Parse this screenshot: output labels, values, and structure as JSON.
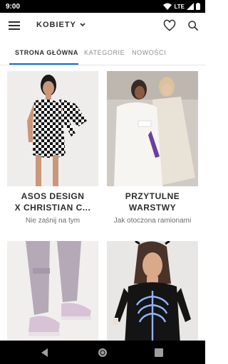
{
  "status": {
    "time": "9:00",
    "network": "LTE"
  },
  "header": {
    "department": "KOBIETY"
  },
  "tabs": [
    {
      "label": "STRONA GŁÓWNA",
      "active": true
    },
    {
      "label": "KATEGORIE",
      "active": false
    },
    {
      "label": "NOWOŚCI",
      "active": false
    }
  ],
  "cards": [
    {
      "title": "ASOS DESIGN\nX CHRISTIAN C...",
      "subtitle": "Nie zaśnij na tym"
    },
    {
      "title": "PRZYTULNE\nWARSTWY",
      "subtitle": "Jak otoczona ramionami"
    },
    {
      "title": "",
      "subtitle": ""
    },
    {
      "title": "",
      "subtitle": ""
    }
  ],
  "colors": {
    "accent": "#0770cf",
    "text": "#2d2d2d",
    "muted": "#8c8c8c"
  },
  "icons": [
    "menu-icon",
    "chevron-down-icon",
    "heart-icon",
    "search-icon",
    "back-icon",
    "home-icon",
    "recents-icon"
  ]
}
